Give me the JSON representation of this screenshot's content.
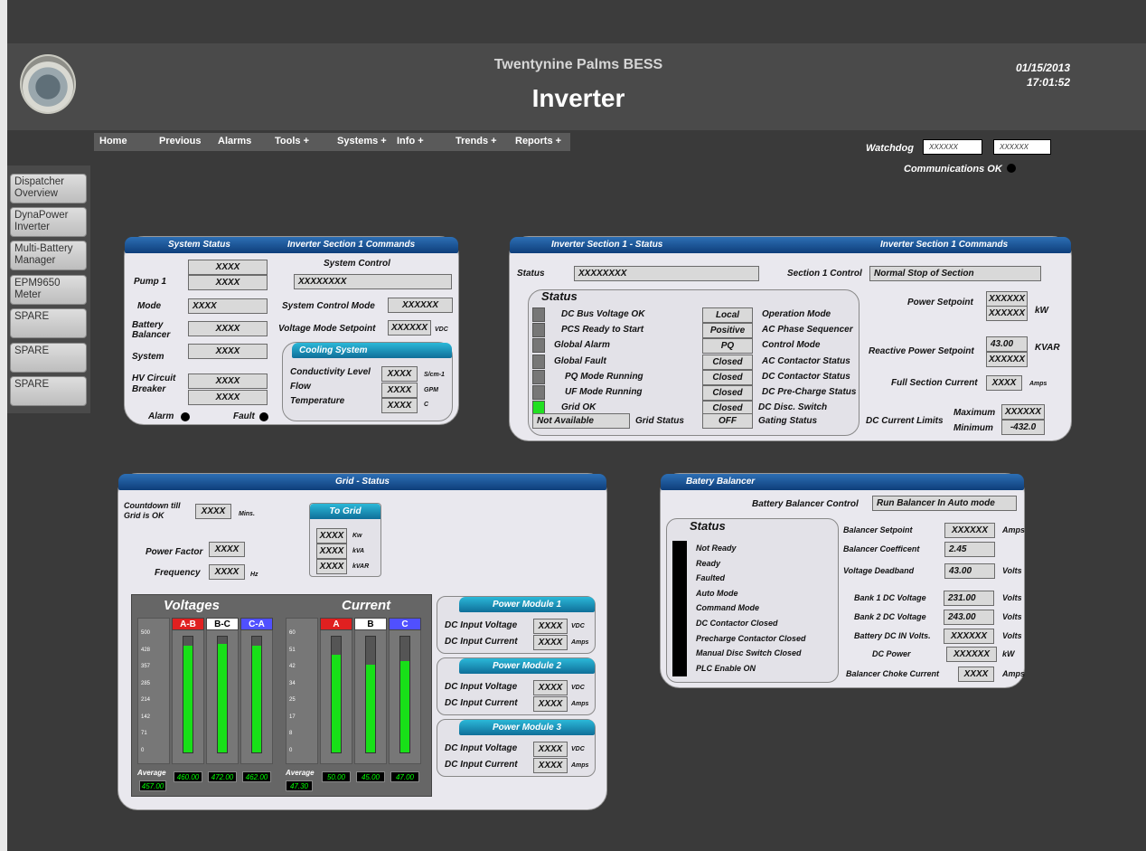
{
  "header": {
    "plant": "Twentynine Palms BESS",
    "title": "Inverter",
    "date": "01/15/2013",
    "time": "17:01:52"
  },
  "menu": [
    "Home",
    "Previous",
    "Alarms",
    "Tools +",
    "Systems +",
    "Info +",
    "Trends +",
    "Reports +"
  ],
  "watchdog": {
    "label": "Watchdog",
    "v1": "XXXXXX",
    "v2": "XXXXXX",
    "comms": "Communications OK"
  },
  "sidenav": [
    "Dispatcher Overview",
    "DynaPower Inverter",
    "Multi-Battery Manager",
    "EPM9650 Meter",
    "SPARE",
    "SPARE",
    "SPARE"
  ],
  "sys": {
    "title": "System Status",
    "cmd_title": "Inverter Section 1 Commands",
    "pump": "Pump 1",
    "pump_v1": "XXXX",
    "pump_v2": "XXXX",
    "mode": "Mode",
    "mode_v": "XXXX",
    "bb": "Battery Balancer",
    "bb_v": "XXXX",
    "system": "System",
    "system_v": "XXXX",
    "hv": "HV Circuit Breaker",
    "hv_v1": "XXXX",
    "hv_v2": "XXXX",
    "alarm": "Alarm",
    "fault": "Fault",
    "sc": "System Control",
    "sc_v": "XXXXXXXX",
    "scm": "System Control Mode",
    "scm_v": "XXXXXX",
    "vms": "Voltage Mode Setpoint",
    "vms_v": "XXXXXX",
    "vdc": "VDC"
  },
  "cool": {
    "title": "Cooling System",
    "cond": "Conductivity Level",
    "cond_v": "XXXX",
    "cond_u": "S/cm-1",
    "flow": "Flow",
    "flow_v": "XXXX",
    "flow_u": "GPM",
    "temp": "Temperature",
    "temp_v": "XXXX",
    "temp_u": "C"
  },
  "inv": {
    "title": "Inverter Section 1 - Status",
    "cmd_title": "Inverter Section 1 Commands",
    "status_lbl": "Status",
    "status_v": "XXXXXXXX",
    "s1c": "Section 1 Control",
    "s1c_v": "Normal Stop of Section",
    "box_title": "Status",
    "items": [
      {
        "label": "DC Bus Voltage OK",
        "val": "Local",
        "desc": "Operation Mode",
        "on": false
      },
      {
        "label": "PCS Ready to Start",
        "val": "Positive",
        "desc": "AC Phase Sequencer",
        "on": false
      },
      {
        "label": "Global Alarm",
        "val": "PQ",
        "desc": "Control Mode",
        "on": false
      },
      {
        "label": "Global Fault",
        "val": "Closed",
        "desc": "AC Contactor Status",
        "on": false
      },
      {
        "label": "PQ Mode Running",
        "val": "Closed",
        "desc": "DC Contactor Status",
        "on": false
      },
      {
        "label": "UF Mode Running",
        "val": "Closed",
        "desc": "DC Pre-Charge Status",
        "on": false
      },
      {
        "label": "Grid OK",
        "val": "Closed",
        "desc": "DC Disc. Switch",
        "on": true
      }
    ],
    "na": "Not Available",
    "grid_status": "Grid Status",
    "gating_v": "OFF",
    "gating": "Gating Status",
    "ps": "Power Setpoint",
    "ps_v1": "XXXXXX",
    "ps_v2": "XXXXXX",
    "kw": "kW",
    "rps": "Reactive Power Setpoint",
    "rps_v1": "43.00",
    "rps_v2": "XXXXXX",
    "kvar": "KVAR",
    "fsc": "Full Section Current",
    "fsc_v": "XXXX",
    "amps": "Amps",
    "dcl": "DC Current Limits",
    "max": "Maximum",
    "max_v": "XXXXXX",
    "min": "Minimum",
    "min_v": "-432.0"
  },
  "grid": {
    "title": "Grid - Status",
    "countdown": "Countdown till Grid is OK",
    "countdown_v": "XXXX",
    "mins": "Mins.",
    "pf": "Power Factor",
    "pf_v": "XXXX",
    "freq": "Frequency",
    "freq_v": "XXXX",
    "hz": "Hz",
    "tog": "To Grid",
    "tog_rows": [
      {
        "v": "XXXX",
        "u": "Kw"
      },
      {
        "v": "XXXX",
        "u": "kVA"
      },
      {
        "v": "XXXX",
        "u": "kVAR"
      }
    ],
    "voltages": "Voltages",
    "current": "Current",
    "average": "Average",
    "vticks": [
      "500",
      "428",
      "357",
      "285",
      "214",
      "142",
      "71",
      "0"
    ],
    "cticks": [
      "60",
      "51",
      "42",
      "34",
      "25",
      "17",
      "8",
      "0"
    ],
    "volt_phases": [
      {
        "name": "A-B",
        "avg": "460.00",
        "level": 0.92,
        "color": "#e02020",
        "text": "#fff"
      },
      {
        "name": "B-C",
        "avg": "472.00",
        "level": 0.94,
        "color": "#ffffff",
        "text": "#000"
      },
      {
        "name": "C-A",
        "avg": "462.00",
        "level": 0.92,
        "color": "#5050ff",
        "text": "#fff"
      }
    ],
    "volt_avg": "457.00",
    "cur_phases": [
      {
        "name": "A",
        "avg": "50.00",
        "level": 0.84,
        "color": "#e02020",
        "text": "#fff"
      },
      {
        "name": "B",
        "avg": "45.00",
        "level": 0.76,
        "color": "#ffffff",
        "text": "#000"
      },
      {
        "name": "C",
        "avg": "47.00",
        "level": 0.79,
        "color": "#5050ff",
        "text": "#fff"
      }
    ],
    "cur_avg": "47.30",
    "modules": [
      {
        "title": "Power Module 1",
        "dciv": "DC Input Voltage",
        "v": "XXXX",
        "vu": "VDC",
        "dcic": "DC Input Current",
        "c": "XXXX",
        "cu": "Amps"
      },
      {
        "title": "Power Module 2",
        "dciv": "DC Input Voltage",
        "v": "XXXX",
        "vu": "VDC",
        "dcic": "DC Input Current",
        "c": "XXXX",
        "cu": "Amps"
      },
      {
        "title": "Power Module 3",
        "dciv": "DC Input Voltage",
        "v": "XXXX",
        "vu": "VDC",
        "dcic": "DC Input Current",
        "c": "XXXX",
        "cu": "Amps"
      }
    ]
  },
  "bal": {
    "title": "Batery Balancer",
    "ctrl": "Battery Balancer Control",
    "ctrl_v": "Run Balancer In Auto mode",
    "status": "Status",
    "items": [
      "Not Ready",
      "Ready",
      "Faulted",
      "Auto Mode",
      "Command Mode",
      "DC Contactor Closed",
      "Precharge Contactor Closed",
      "Manual Disc Switch Closed",
      "PLC Enable ON"
    ],
    "rows": [
      {
        "l": "Balancer Setpoint",
        "v": "XXXXXX",
        "u": "Amps"
      },
      {
        "l": "Balancer Coefficent",
        "v": "2.45",
        "u": ""
      },
      {
        "l": "Voltage Deadband",
        "v": "43.00",
        "u": "Volts"
      },
      {
        "l": "Bank 1 DC Voltage",
        "v": "231.00",
        "u": "Volts"
      },
      {
        "l": "Bank 2 DC Voltage",
        "v": "243.00",
        "u": "Volts"
      },
      {
        "l": "Battery DC IN Volts.",
        "v": "XXXXXX",
        "u": "Volts"
      },
      {
        "l": "DC Power",
        "v": "XXXXXX",
        "u": "kW"
      },
      {
        "l": "Balancer Choke Current",
        "v": "XXXX",
        "u": "Amps"
      }
    ]
  }
}
